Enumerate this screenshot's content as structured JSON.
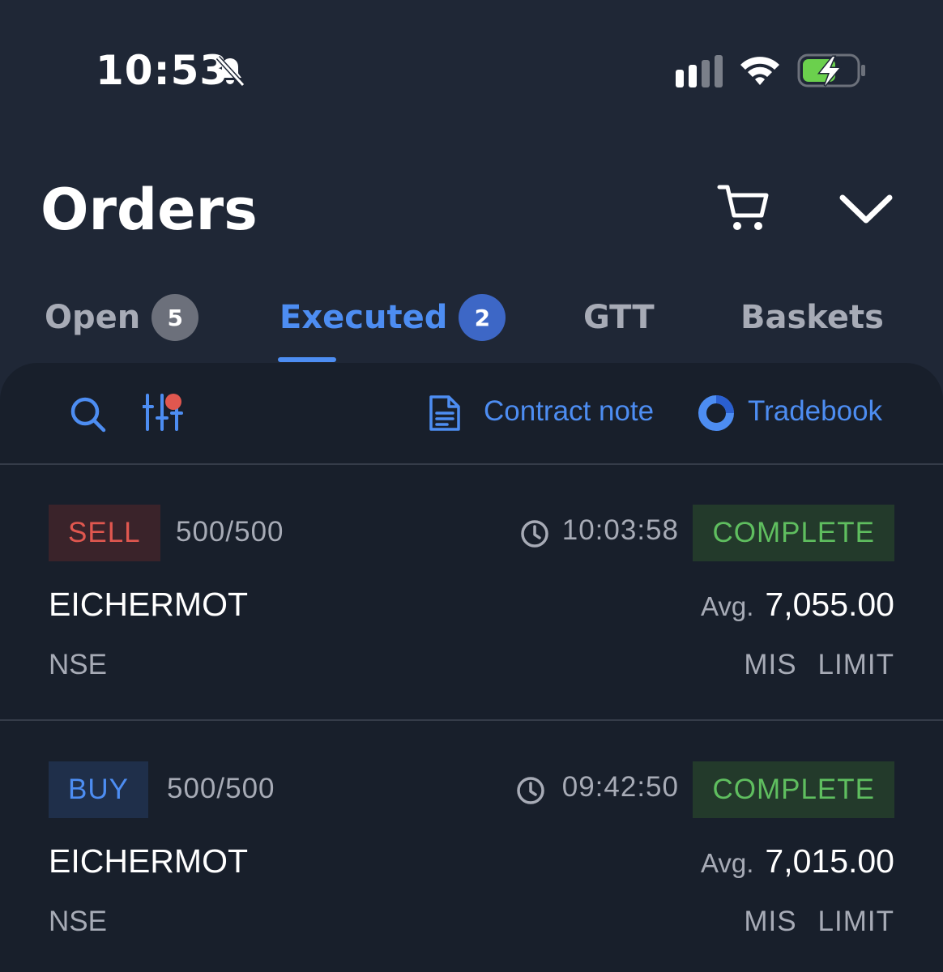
{
  "status_bar": {
    "time": "10:53"
  },
  "header": {
    "title": "Orders"
  },
  "tabs": [
    {
      "label": "Open",
      "badge": "5"
    },
    {
      "label": "Executed",
      "badge": "2"
    },
    {
      "label": "GTT"
    },
    {
      "label": "Baskets"
    }
  ],
  "active_tab": "Executed",
  "toolbar": {
    "contract_note_label": "Contract note",
    "tradebook_label": "Tradebook"
  },
  "orders": [
    {
      "side": "SELL",
      "qty": "500/500",
      "time": "10:03:58",
      "status": "COMPLETE",
      "symbol": "EICHERMOT",
      "avg_label": "Avg.",
      "avg_price": "7,055.00",
      "exchange": "NSE",
      "product": "MIS",
      "order_type": "LIMIT"
    },
    {
      "side": "BUY",
      "qty": "500/500",
      "time": "09:42:50",
      "status": "COMPLETE",
      "symbol": "EICHERMOT",
      "avg_label": "Avg.",
      "avg_price": "7,015.00",
      "exchange": "NSE",
      "product": "MIS",
      "order_type": "LIMIT"
    }
  ],
  "colors": {
    "background": "#1f2736",
    "panel": "#181f2b",
    "accent": "#4d8df2",
    "sell": "#e0574f",
    "complete": "#5fbe5f",
    "battery": "#6bd04d"
  }
}
